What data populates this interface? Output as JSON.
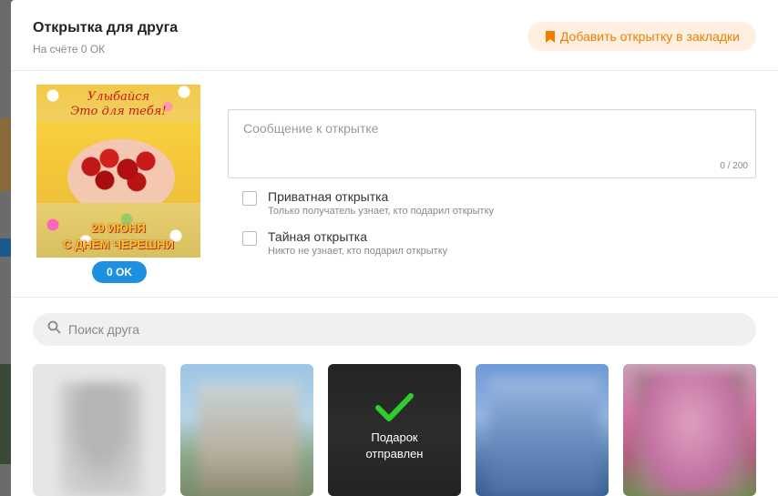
{
  "dialog": {
    "title": "Открытка для друга",
    "balance": "На счёте 0 ОК",
    "bookmark_button": "Добавить открытку в закладки"
  },
  "card": {
    "line1": "Улыбайся",
    "line2": "Это для тебя!",
    "date_line1": "29 ИЮНЯ",
    "date_line2": "С ДНЕМ ЧЕРЕШНИ",
    "price": "0 OK"
  },
  "message": {
    "placeholder": "Сообщение к открытке",
    "counter": "0 / 200"
  },
  "options": [
    {
      "label": "Приватная открытка",
      "hint": "Только получатель узнает, кто подарил открытку",
      "checked": false
    },
    {
      "label": "Тайная открытка",
      "hint": "Никто не узнает, кто подарил открытку",
      "checked": false
    }
  ],
  "search": {
    "placeholder": "Поиск друга"
  },
  "friends": {
    "sent_label_line1": "Подарок",
    "sent_label_line2": "отправлен"
  },
  "colors": {
    "accent_orange": "#f07d00",
    "bookmark_bg": "#fdf0e0",
    "price_blue": "#1e90e0",
    "check_green": "#2ecc2e"
  }
}
